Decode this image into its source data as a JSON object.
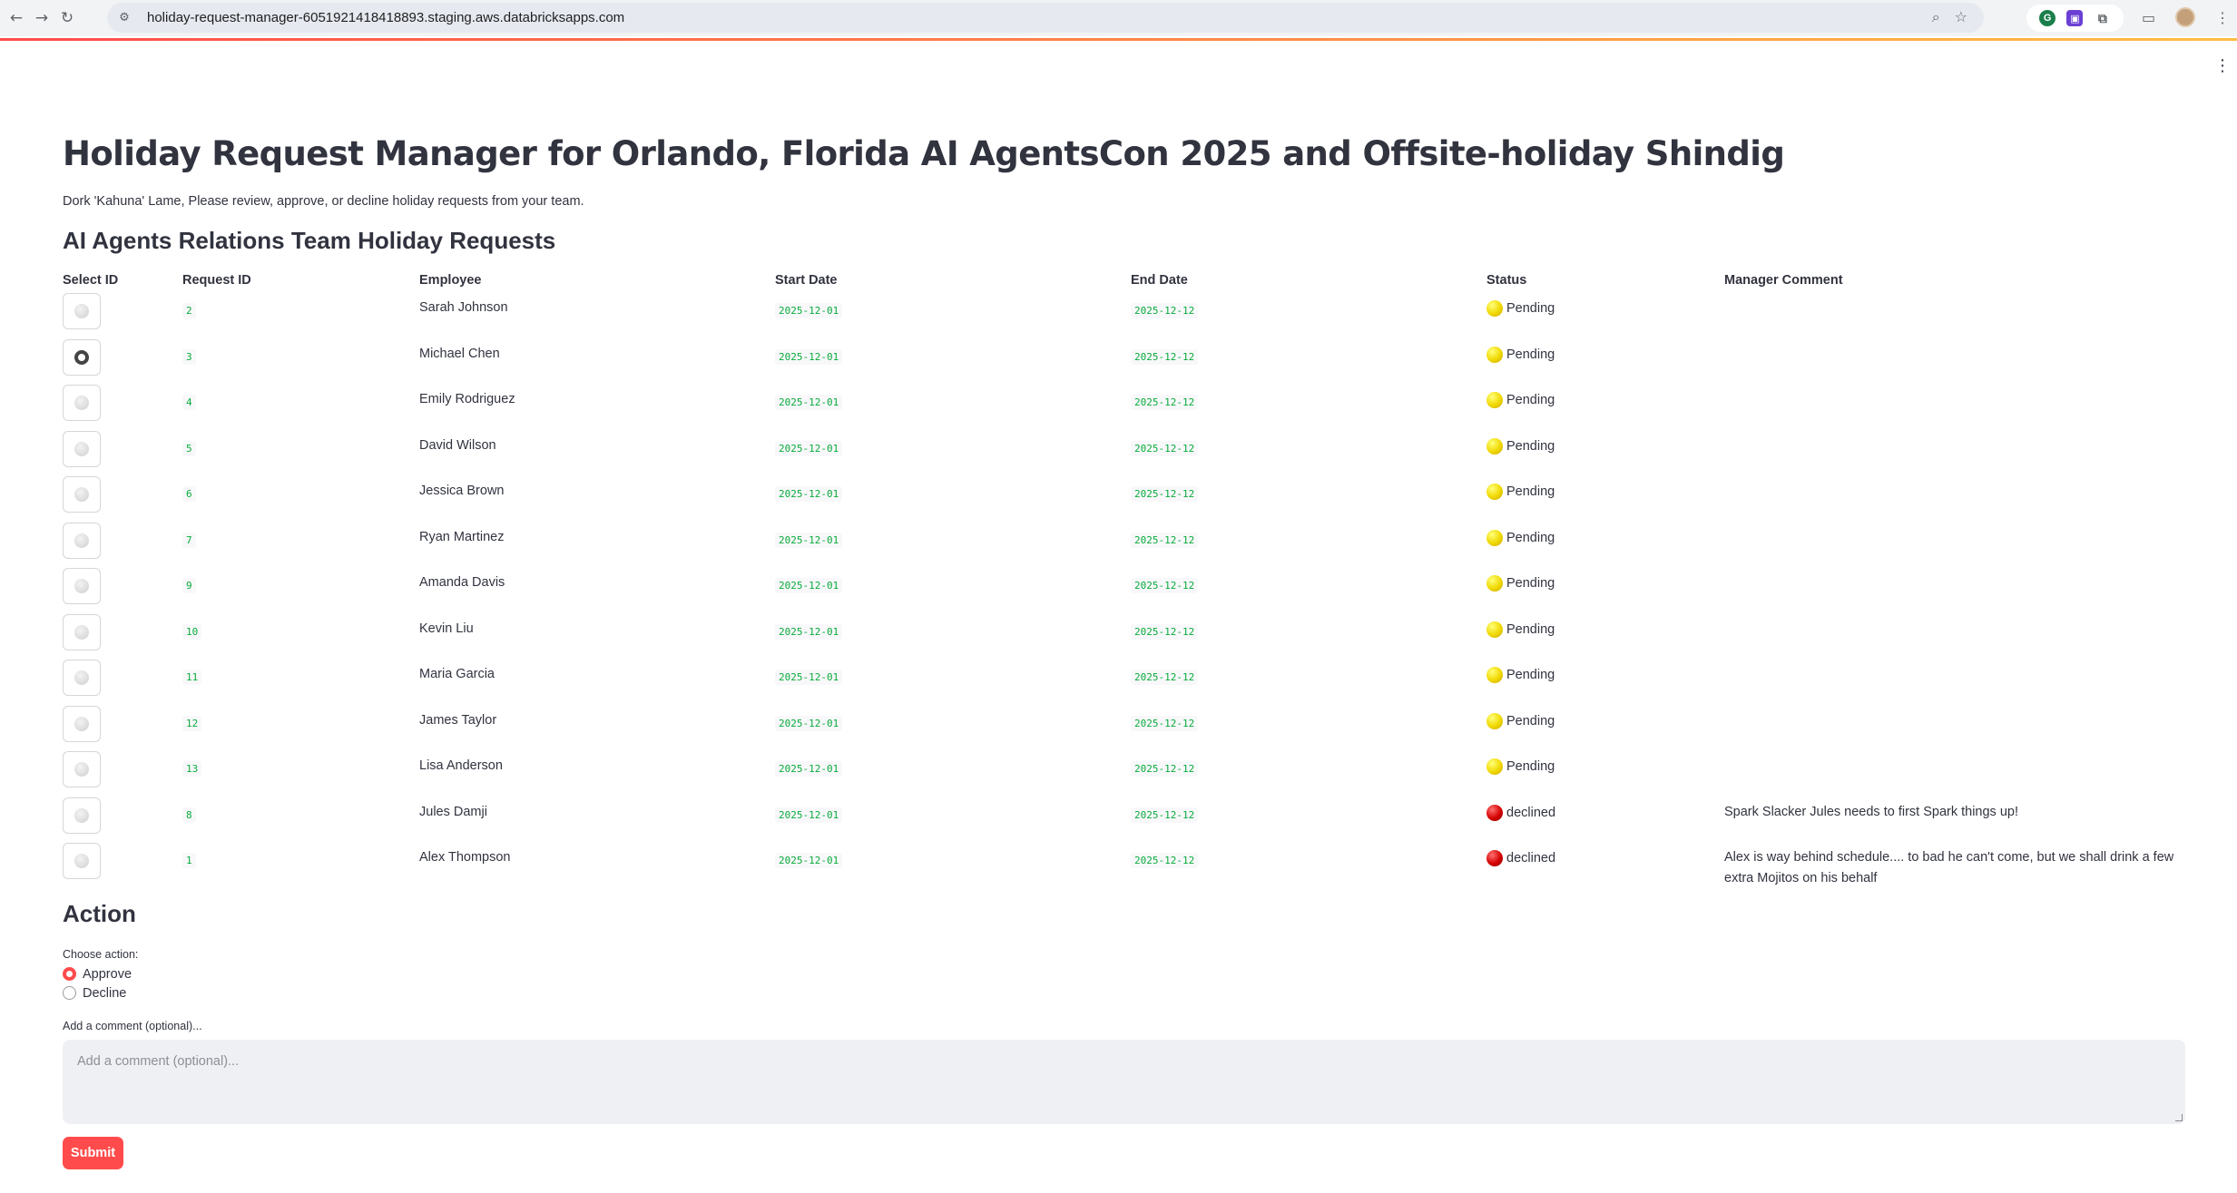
{
  "browser": {
    "url": "holiday-request-manager-6051921418418893.staging.aws.databricksapps.com"
  },
  "app": {
    "title": "Holiday Request Manager for Orlando, Florida AI AgentsCon 2025 and Offsite-holiday Shindig",
    "subtitle": "Dork 'Kahuna' Lame, Please review, approve, or decline holiday requests from your team.",
    "section_title": "AI Agents Relations Team Holiday Requests"
  },
  "table": {
    "columns": [
      "Select ID",
      "Request ID",
      "Employee",
      "Start Date",
      "End Date",
      "Status",
      "Manager Comment"
    ],
    "rows": [
      {
        "request_id": "2",
        "employee": "Sarah Johnson",
        "start": "2025-12-01",
        "end": "2025-12-12",
        "status": "Pending",
        "status_type": "pending",
        "comment": "",
        "selected": false
      },
      {
        "request_id": "3",
        "employee": "Michael Chen",
        "start": "2025-12-01",
        "end": "2025-12-12",
        "status": "Pending",
        "status_type": "pending",
        "comment": "",
        "selected": true
      },
      {
        "request_id": "4",
        "employee": "Emily Rodriguez",
        "start": "2025-12-01",
        "end": "2025-12-12",
        "status": "Pending",
        "status_type": "pending",
        "comment": "",
        "selected": false
      },
      {
        "request_id": "5",
        "employee": "David Wilson",
        "start": "2025-12-01",
        "end": "2025-12-12",
        "status": "Pending",
        "status_type": "pending",
        "comment": "",
        "selected": false
      },
      {
        "request_id": "6",
        "employee": "Jessica Brown",
        "start": "2025-12-01",
        "end": "2025-12-12",
        "status": "Pending",
        "status_type": "pending",
        "comment": "",
        "selected": false
      },
      {
        "request_id": "7",
        "employee": "Ryan Martinez",
        "start": "2025-12-01",
        "end": "2025-12-12",
        "status": "Pending",
        "status_type": "pending",
        "comment": "",
        "selected": false
      },
      {
        "request_id": "9",
        "employee": "Amanda Davis",
        "start": "2025-12-01",
        "end": "2025-12-12",
        "status": "Pending",
        "status_type": "pending",
        "comment": "",
        "selected": false
      },
      {
        "request_id": "10",
        "employee": "Kevin Liu",
        "start": "2025-12-01",
        "end": "2025-12-12",
        "status": "Pending",
        "status_type": "pending",
        "comment": "",
        "selected": false
      },
      {
        "request_id": "11",
        "employee": "Maria Garcia",
        "start": "2025-12-01",
        "end": "2025-12-12",
        "status": "Pending",
        "status_type": "pending",
        "comment": "",
        "selected": false
      },
      {
        "request_id": "12",
        "employee": "James Taylor",
        "start": "2025-12-01",
        "end": "2025-12-12",
        "status": "Pending",
        "status_type": "pending",
        "comment": "",
        "selected": false
      },
      {
        "request_id": "13",
        "employee": "Lisa Anderson",
        "start": "2025-12-01",
        "end": "2025-12-12",
        "status": "Pending",
        "status_type": "pending",
        "comment": "",
        "selected": false
      },
      {
        "request_id": "8",
        "employee": "Jules Damji",
        "start": "2025-12-01",
        "end": "2025-12-12",
        "status": "declined",
        "status_type": "declined",
        "comment": "Spark Slacker Jules needs to first Spark things up!",
        "selected": false
      },
      {
        "request_id": "1",
        "employee": "Alex Thompson",
        "start": "2025-12-01",
        "end": "2025-12-12",
        "status": "declined",
        "status_type": "declined",
        "comment": "Alex is way behind schedule.... to bad he can't come, but we shall drink a few extra Mojitos on his behalf",
        "selected": false
      }
    ]
  },
  "action": {
    "title": "Action",
    "choose_label": "Choose action:",
    "options": [
      "Approve",
      "Decline"
    ],
    "selected": "Approve",
    "comment_label": "Add a comment (optional)...",
    "comment_placeholder": "Add a comment (optional)...",
    "comment_value": "",
    "submit_label": "Submit"
  },
  "colors": {
    "accent": "#ff4b4b",
    "code_green": "#09ab3b",
    "pending": "#f0d800",
    "declined": "#d50000"
  }
}
